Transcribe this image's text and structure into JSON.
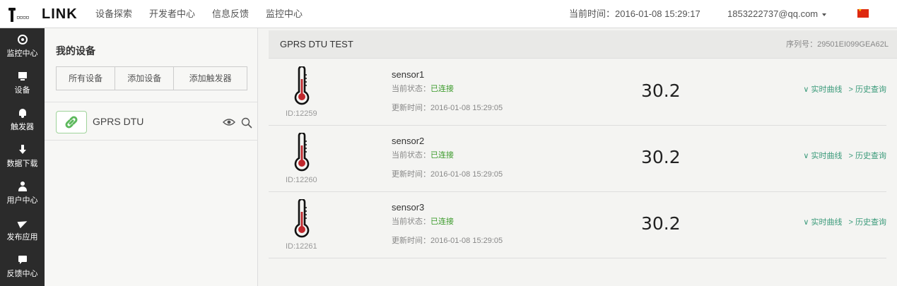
{
  "header": {
    "logo_text": "LINK",
    "logo_dots": "▫▫▫▫",
    "nav": [
      "设备探索",
      "开发者中心",
      "信息反馈",
      "监控中心"
    ],
    "time_label": "当前时间：2016-01-08 15:29:17",
    "user": "1853222737@qq.com",
    "flag_icon": "china-flag-icon"
  },
  "sidebar": {
    "items": [
      {
        "icon": "target-icon",
        "label": "监控中心"
      },
      {
        "icon": "monitor-icon",
        "label": "设备"
      },
      {
        "icon": "bell-icon",
        "label": "触发器"
      },
      {
        "icon": "download-icon",
        "label": "数据下载"
      },
      {
        "icon": "user-icon",
        "label": "用户中心"
      },
      {
        "icon": "send-icon",
        "label": "发布应用"
      },
      {
        "icon": "chat-icon",
        "label": "反馈中心"
      }
    ]
  },
  "devices": {
    "title": "我的设备",
    "buttons": [
      "所有设备",
      "添加设备",
      "添加触发器"
    ],
    "list": [
      {
        "name": "GPRS DTU"
      }
    ]
  },
  "main": {
    "title": "GPRS DTU TEST",
    "serial": "序列号：29501EI099GEA62L",
    "sensors": [
      {
        "name": "sensor1",
        "id": "ID:12259",
        "status_label": "当前状态：",
        "status": "已连接",
        "updated": "更新时间：2016-01-08 15:29:05",
        "value": "30.2",
        "link_curve": "∨ 实时曲线",
        "link_history": "> 历史查询"
      },
      {
        "name": "sensor2",
        "id": "ID:12260",
        "status_label": "当前状态：",
        "status": "已连接",
        "updated": "更新时间：2016-01-08 15:29:05",
        "value": "30.2",
        "link_curve": "∨ 实时曲线",
        "link_history": "> 历史查询"
      },
      {
        "name": "sensor3",
        "id": "ID:12261",
        "status_label": "当前状态：",
        "status": "已连接",
        "updated": "更新时间：2016-01-08 15:29:05",
        "value": "30.2",
        "link_curve": "∨ 实时曲线",
        "link_history": "> 历史查询"
      }
    ]
  },
  "colors": {
    "sidebar_bg": "#2b2b2b",
    "connected": "#3a9a2a",
    "link": "#3a9a7a",
    "thermo_red": "#c0282d"
  }
}
